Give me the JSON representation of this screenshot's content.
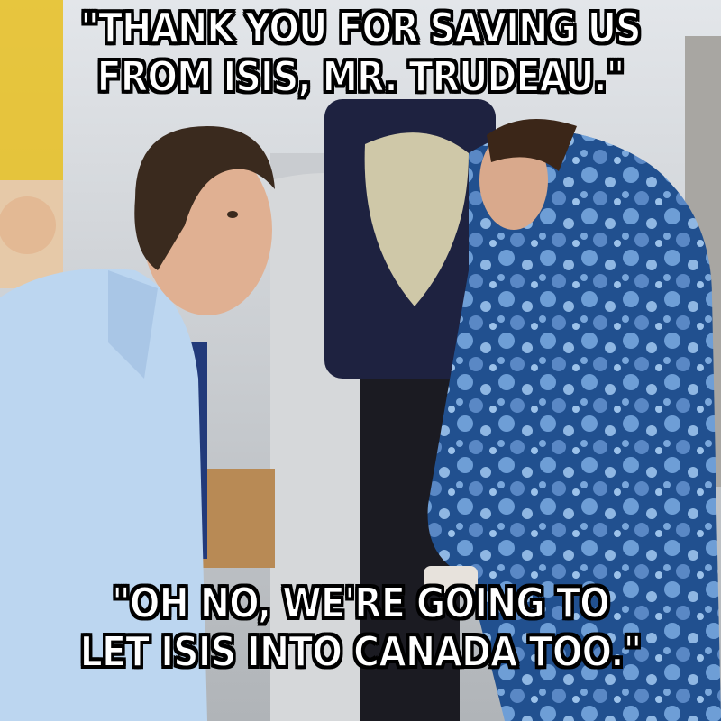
{
  "meme": {
    "top_caption": "\"THANK YOU FOR SAVING US\nFROM ISIS, MR. TRUDEAU.\"",
    "bottom_caption": "\"OH NO, WE'RE GOING TO\nLET ISIS INTO CANADA TOO.\""
  },
  "colors": {
    "jacket_blue": "#1f4f95",
    "jacket_dots": "#6f9fd6",
    "shirt_light_blue": "#bcd6f0",
    "sweater_navy": "#1e2240",
    "text_white": "#ffffff",
    "text_outline": "#000000"
  }
}
